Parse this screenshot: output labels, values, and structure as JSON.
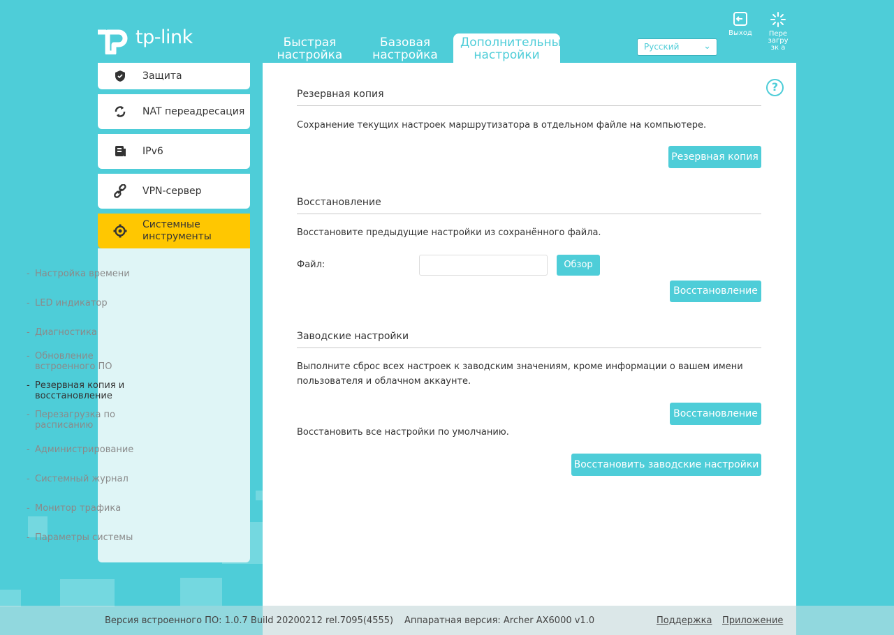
{
  "header": {
    "logo_text": "tp-link",
    "nav": [
      {
        "label": "Быстрая настройка"
      },
      {
        "label": "Базовая настройка"
      },
      {
        "label": "Дополнительные настройки"
      }
    ],
    "language": "Русский",
    "logout_label": "Выход",
    "reboot_label": "Пере загрузк а"
  },
  "sidebar": {
    "items": [
      {
        "label": "Защита",
        "icon": "shield-icon"
      },
      {
        "label": "NAT переадресация",
        "icon": "nat-icon"
      },
      {
        "label": "IPv6",
        "icon": "ipv6-icon"
      },
      {
        "label": "VPN-сервер",
        "icon": "link-icon"
      },
      {
        "label": "Системные инструменты",
        "icon": "gear-icon"
      }
    ],
    "submenu": [
      {
        "label": "Настройка времени"
      },
      {
        "label": "LED индикатор"
      },
      {
        "label": "Диагностика"
      },
      {
        "label": "Обновление встроенного ПО"
      },
      {
        "label": "Резервная копия и восстановление"
      },
      {
        "label": "Перезагрузка по расписанию"
      },
      {
        "label": "Администрирование"
      },
      {
        "label": "Системный журнал"
      },
      {
        "label": "Монитор трафика"
      },
      {
        "label": "Параметры системы"
      }
    ]
  },
  "backup": {
    "title": "Резервная копия",
    "description": "Сохранение текущих настроек маршрутизатора в отдельном файле на компьютере.",
    "button": "Резервная копия"
  },
  "restore": {
    "title": "Восстановление",
    "description": "Восстановите предыдущие настройки из сохранённого файла.",
    "file_label": "Файл:",
    "file_value": "",
    "browse_button": "Обзор",
    "button": "Восстановление"
  },
  "factory": {
    "title": "Заводские настройки",
    "description_line1": "Выполните сброс всех настроек к заводским значениям, кроме информации о вашем имени",
    "description_line2": "пользователя и облачном аккаунте.",
    "restore_button": "Восстановление",
    "default_text": "Восстановить все настройки по умолчанию.",
    "factory_button": "Восстановить заводские настройки"
  },
  "footer": {
    "firmware": "Версия встроенного ПО: 1.0.7 Build 20200212 rel.7095(4555)",
    "hardware": "Аппаратная версия: Archer AX6000 v1.0",
    "support": "Поддержка",
    "app": "Приложение"
  },
  "colors": {
    "background": "#4ecdd8",
    "accent": "#4ecdd8",
    "active_menu": "#ffc701"
  }
}
